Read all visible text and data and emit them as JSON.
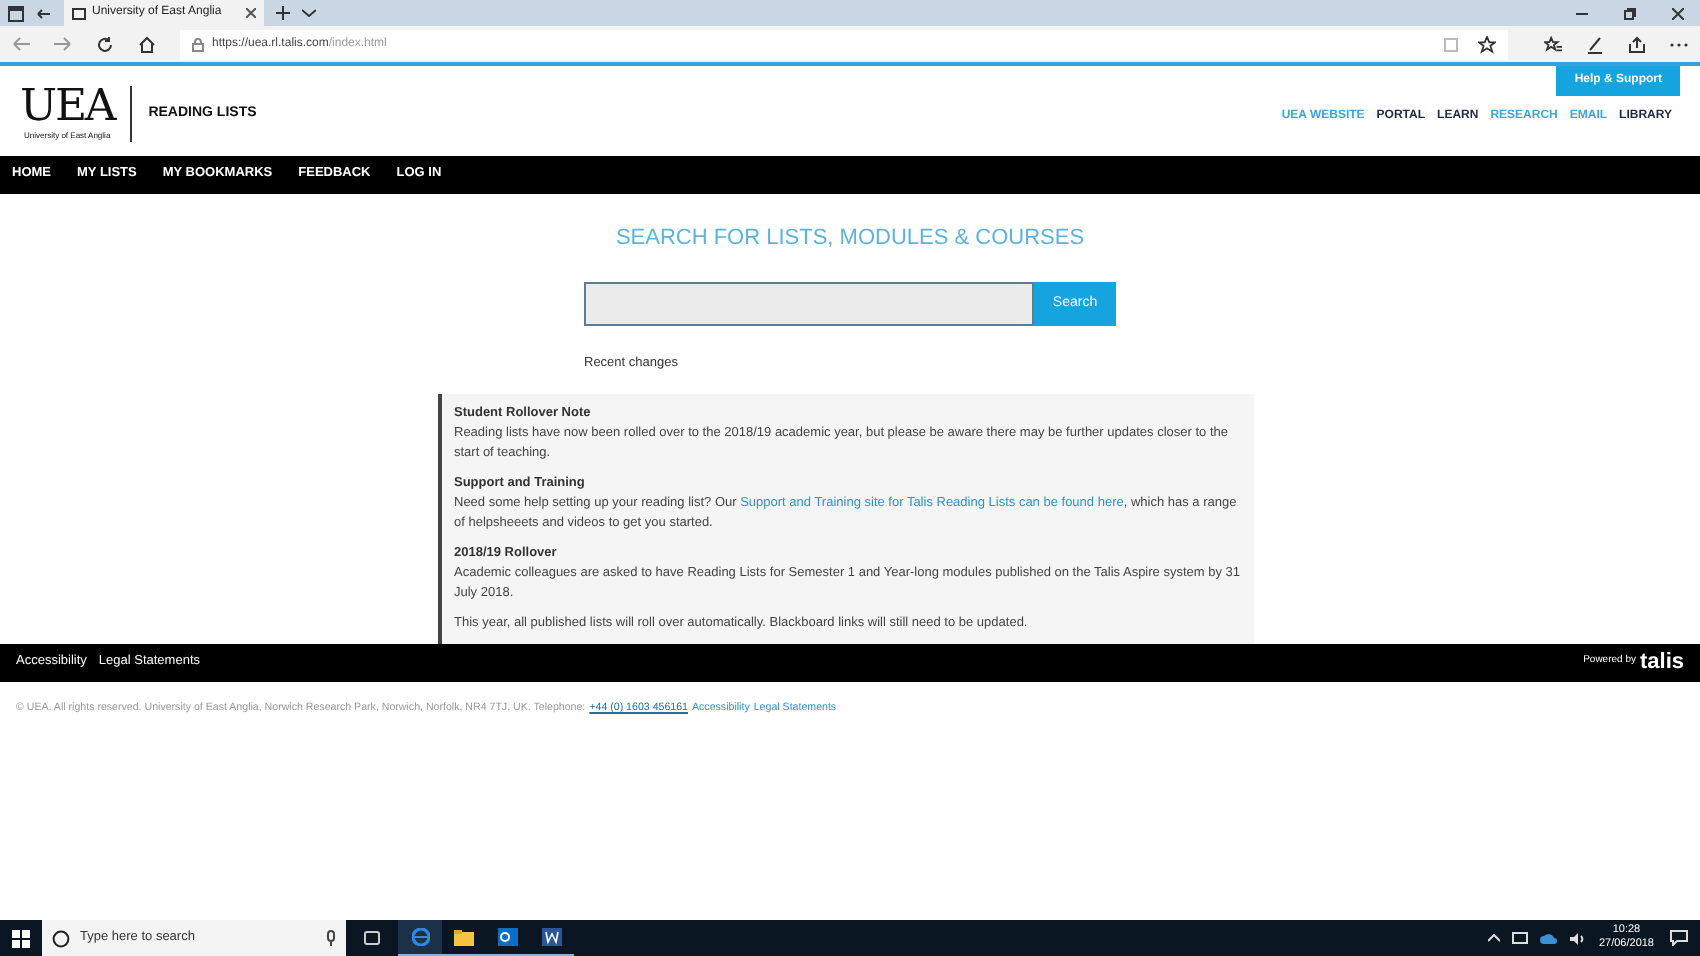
{
  "browser": {
    "tab_title": "University of East Anglia",
    "url_host": "https://uea.rl.talis.com",
    "url_path": "/index.html"
  },
  "header": {
    "logo_text": "UEA",
    "logo_subtitle": "University of East Anglia",
    "site_title": "READING LISTS",
    "help_button": "Help & Support",
    "top_links": [
      {
        "label": "UEA WEBSITE",
        "color": "#3aa6dc"
      },
      {
        "label": "PORTAL",
        "color": "#1f2a44"
      },
      {
        "label": "LEARN",
        "color": "#1f2a44"
      },
      {
        "label": "RESEARCH",
        "color": "#3aa6dc"
      },
      {
        "label": "EMAIL",
        "color": "#3aa6dc"
      },
      {
        "label": "LIBRARY",
        "color": "#1f2a44"
      }
    ]
  },
  "nav": [
    "HOME",
    "MY LISTS",
    "MY BOOKMARKS",
    "FEEDBACK",
    "LOG IN"
  ],
  "search": {
    "heading": "SEARCH FOR LISTS, MODULES & COURSES",
    "button": "Search",
    "recent_link": "Recent changes"
  },
  "notices": [
    {
      "title": "Student Rollover Note",
      "paragraphs": [
        [
          {
            "text": "Reading lists have now been rolled over to the 2018/19 academic year, but please be aware there may be further updates closer to the start of teaching.",
            "link": false
          }
        ]
      ]
    },
    {
      "title": "Support and Training",
      "paragraphs": [
        [
          {
            "text": "Need some help setting up your reading list? Our ",
            "link": false
          },
          {
            "text": "Support and Training site for Talis Reading Lists can be found here",
            "link": true
          },
          {
            "text": ", which has a range of helpsheeets and videos to get you started.",
            "link": false
          }
        ]
      ]
    },
    {
      "title": "2018/19 Rollover",
      "paragraphs": [
        [
          {
            "text": "Academic colleagues are asked to have Reading Lists for Semester 1 and Year-long modules published on the Talis Aspire system by 31 July 2018.",
            "link": false
          }
        ],
        [
          {
            "text": "This year, all published lists will roll over automatically. Blackboard links will still need to be updated.",
            "link": false
          }
        ]
      ]
    }
  ],
  "footer": {
    "links": [
      "Accessibility",
      "Legal Statements"
    ],
    "powered_by": "Powered by",
    "brand": "talis",
    "copyright": "© UEA. All rights reserved. University of East Anglia, Norwich Research Park, Norwich, Norfolk, NR4 7TJ, UK. Telephone:",
    "phone": "+44 (0) 1603 456161",
    "bottom_links": [
      "Accessibility",
      "Legal Statements"
    ]
  },
  "taskbar": {
    "search_placeholder": "Type here to search",
    "time": "10:28",
    "date": "27/06/2018"
  }
}
